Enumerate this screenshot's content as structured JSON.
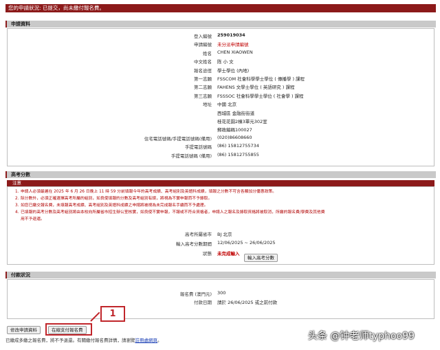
{
  "status": {
    "text": "您的申請狀況: 已提交，尚未繳付報名費。"
  },
  "application_section": {
    "title": "申請資料",
    "fields": [
      {
        "label": "登入編號",
        "value": "259019034",
        "style": "bold"
      },
      {
        "label": "申請編號",
        "value": "未分派申請編號",
        "style": "red"
      },
      {
        "label": "姓名",
        "value": "CHEN XIAOWEN",
        "style": ""
      },
      {
        "label": "中文姓名",
        "value": "陈 小 文",
        "style": ""
      },
      {
        "label": "報名途徑",
        "value": "學士學位 (內地)",
        "style": ""
      },
      {
        "label": "第一志願",
        "value": "FSSCOM 社會科學學士學位 ( 傳播學 ) 課程",
        "style": ""
      },
      {
        "label": "第二志願",
        "value": "FAHENS 文學士學位 ( 英語研究 ) 課程",
        "style": ""
      },
      {
        "label": "第三志願",
        "value": "FSSSOC 社會科學學士學位 ( 社會學 ) 課程",
        "style": ""
      },
      {
        "label": "地址",
        "value": "中國 北京",
        "style": ""
      },
      {
        "label": "",
        "value": "西城區 金融街街道",
        "style": ""
      },
      {
        "label": "",
        "value": "桂花花園2棟3單元302室",
        "style": ""
      },
      {
        "label": "",
        "value": "郵政編碼100027",
        "style": ""
      },
      {
        "label": "住宅電話號碼/手提電話號碼(備用)",
        "value": "(020)86608660",
        "style": ""
      },
      {
        "label": "手提電話號碼",
        "value": "(86)  15812755734",
        "style": ""
      },
      {
        "label": "手提電話號碼 (備用)",
        "value": "(86)  15812755855",
        "style": ""
      }
    ]
  },
  "exam_section": {
    "title": "高考分數",
    "notice_title": "注意",
    "notices": [
      {
        "num": "1.",
        "text": "申請人必須最遲在 2025 年 6 月 26 日晚上 11 時 59 分前填報今年的高考成績、高考組別及英語科成績，填報之分數不可含各類加分優惠政策。"
      },
      {
        "num": "2.",
        "text": "除分數外，必須正確選擇高考所屬的組別，如良使填報的分數及高考組別有誤，將視為不實申報而不予錄取。"
      },
      {
        "num": "3.",
        "text": "如您已繳交報名費，未填報高考成績、高考組別及英語科成績之申請將被視為未完成報名手續而不予處理。"
      },
      {
        "num": "4.",
        "text": "已填報的高考分數及高考組別將由本校向所屬省市招生辦公室核實，如良使不實申報，不報或不符合資格者，申請人之報名及錄取資格將被取消，所繳的報名費/學費及其他費"
      },
      {
        "num": "",
        "text": "用不予退還。"
      }
    ],
    "fields": [
      {
        "label": "高考所屬省市",
        "value": "BJ 北京"
      },
      {
        "label": "輸入高考分數期間",
        "value": "12/06/2025 ~ 26/06/2025"
      },
      {
        "label": "狀態",
        "value": "未完成輸入"
      }
    ],
    "enter_score_button": "輸入高考分數"
  },
  "payment_section": {
    "title": "付款狀況",
    "fields": [
      {
        "label": "報名費 (澳門元)",
        "value": "300"
      },
      {
        "label": "付款日期",
        "value": "請於 26/06/2025 或之前付款"
      }
    ]
  },
  "actions": {
    "modify_button": "修改申請資料",
    "pay_button": "在線支付報名費"
  },
  "callout": {
    "number": "1"
  },
  "footer": {
    "note": "已繳成多繳之報名費，將不予退還。有關繳付報名費詳情，請瀏覽",
    "link": "註冊處網頁",
    "after": "。"
  },
  "watermark": {
    "text": "头条 @钟老师typhoo99"
  },
  "colors": {
    "header": "#8c1a1a",
    "accent": "#c0252a",
    "section": "#c9c9c9"
  }
}
